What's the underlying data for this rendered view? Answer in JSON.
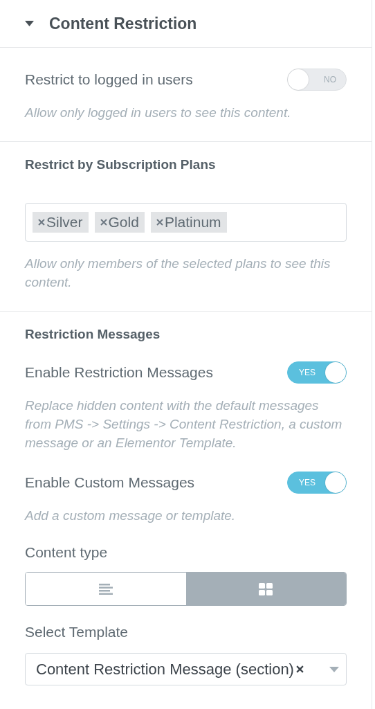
{
  "panel": {
    "title": "Content Restriction",
    "expanded": true
  },
  "sections": [
    {
      "controls": [
        {
          "kind": "switch",
          "label": "Restrict to logged in users",
          "on": false,
          "switch_text": "NO",
          "hint": "Allow only logged in users to see this content."
        }
      ]
    },
    {
      "heading": "Restrict by Subscription Plans",
      "controls": [
        {
          "kind": "tags",
          "tags": [
            "Silver",
            "Gold",
            "Platinum"
          ],
          "hint": "Allow only members of the selected plans to see this content."
        }
      ]
    },
    {
      "heading": "Restriction Messages",
      "controls": [
        {
          "kind": "switch",
          "label": "Enable Restriction Messages",
          "on": true,
          "switch_text": "YES",
          "hint": "Replace hidden content with the default messages from PMS -> Settings -> Content Restriction, a custom message or an Elementor Template."
        },
        {
          "kind": "switch",
          "label": "Enable Custom Messages",
          "on": true,
          "switch_text": "YES",
          "hint": "Add a custom message or template."
        },
        {
          "kind": "choose",
          "label": "Content type",
          "options": [
            {
              "selected": false
            },
            {
              "selected": true
            }
          ]
        },
        {
          "kind": "select",
          "label": "Select Template",
          "value": "Content Restriction Message (section)"
        }
      ]
    }
  ]
}
